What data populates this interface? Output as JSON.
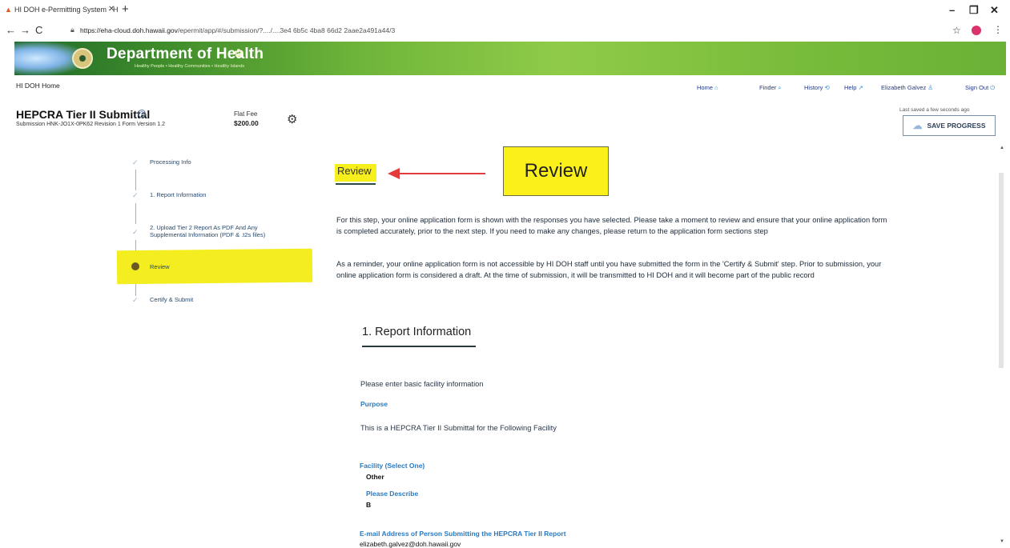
{
  "browser": {
    "tab_title": "HI DOH e-Permitting System - H",
    "tab_close": "✕",
    "new_tab": "+",
    "url_host": "https://eha-cloud.doh.hawaii.gov",
    "url_path": "/epermit/app/#/submission/?..../....3e4 6b5c 4ba8 66d2 2aae2a491a44/3",
    "window_controls": {
      "minimize": "–",
      "maximize": "❐",
      "close": "✕"
    }
  },
  "banner": {
    "title": "Department of Health",
    "tagline": "Healthy People • Healthy Communities • Healthy Islands"
  },
  "nav": {
    "home": "HI DOH Home",
    "links": [
      {
        "label": "Home",
        "icon": "home-icon",
        "glyph": "⌂"
      },
      {
        "label": "Finder",
        "icon": "search-icon",
        "glyph": "⌕"
      },
      {
        "label": "History",
        "icon": "history-icon",
        "glyph": "⟲"
      },
      {
        "label": "Help",
        "icon": "help-icon",
        "glyph": "↗"
      },
      {
        "label": "Elizabeth Galvez",
        "icon": "user-icon",
        "glyph": "♙"
      },
      {
        "label": "Sign Out",
        "icon": "power-icon",
        "glyph": "⏻"
      }
    ]
  },
  "header": {
    "title": "HEPCRA Tier II Submittal",
    "meta": "Submission HNK-JO1X-0PK62   Revision 1   Form Version 1.2",
    "fee_label": "Flat Fee",
    "fee_value": "$200.00",
    "saved_note": "Last saved a few seconds ago",
    "save_button": "SAVE PROGRESS"
  },
  "steps": [
    {
      "label": "Processing Info",
      "state": "complete"
    },
    {
      "label": "1. Report Information",
      "state": "complete"
    },
    {
      "label": "2. Upload Tier 2 Report As PDF And Any Supplemental Information (PDF & .t2s files)",
      "state": "complete"
    },
    {
      "label": "Review",
      "state": "current"
    },
    {
      "label": "Certify & Submit",
      "state": "pending"
    }
  ],
  "main": {
    "heading": "Review",
    "callout": "Review",
    "intro": "For this step, your online application form is shown with the responses you have selected. Please take a moment to review and ensure that your online application form is completed accurately, prior to the next step. If you need to make any changes, please return to the application form sections step",
    "reminder": "As a reminder, your online application form is not accessible by HI DOH staff until you have submitted the form in the 'Certify & Submit' step. Prior to submission, your online application form is considered a draft. At the time of submission, it will be transmitted to HI DOH and it will become part of the public record",
    "section_title": "1. Report Information",
    "section_intro": "Please enter basic facility information",
    "purpose_label": "Purpose",
    "purpose_text": "This is a HEPCRA Tier II Submittal for the Following Facility",
    "facility_label": "Facility (Select One)",
    "facility_value": "Other",
    "describe_label": "Please Describe",
    "describe_value": "B",
    "email_label": "E-mail Address of Person Submitting the HEPCRA Tier II Report",
    "email_value": "elizabeth.galvez@doh.hawaii.gov"
  },
  "colors": {
    "highlight": "#f4ee20",
    "arrow": "#e23b3b",
    "link_blue": "#2a7ac2",
    "banner_green": "#6fb53a"
  }
}
